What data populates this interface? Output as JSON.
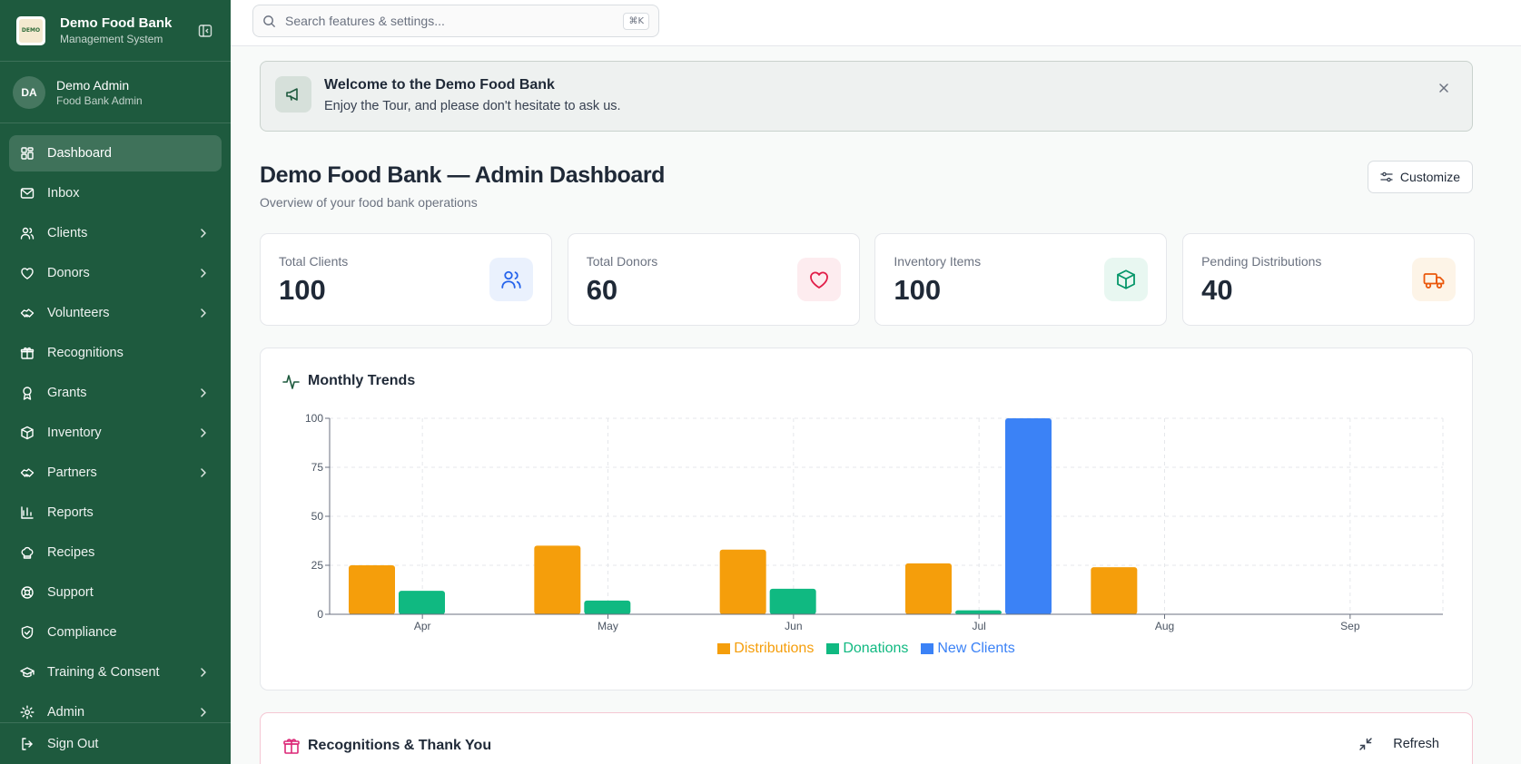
{
  "sidebar": {
    "brand": {
      "name": "Demo Food Bank",
      "subtitle": "Management System",
      "logo_text": "DEMO"
    },
    "user": {
      "initials": "DA",
      "name": "Demo Admin",
      "role": "Food Bank Admin"
    },
    "items": [
      {
        "label": "Dashboard",
        "icon": "dashboard-icon",
        "active": true,
        "has_children": false
      },
      {
        "label": "Inbox",
        "icon": "mail-icon",
        "has_children": false
      },
      {
        "label": "Clients",
        "icon": "users-icon",
        "has_children": true
      },
      {
        "label": "Donors",
        "icon": "heart-icon",
        "has_children": true
      },
      {
        "label": "Volunteers",
        "icon": "handshake-icon",
        "has_children": true
      },
      {
        "label": "Recognitions",
        "icon": "gift-icon",
        "has_children": false
      },
      {
        "label": "Grants",
        "icon": "award-icon",
        "has_children": true
      },
      {
        "label": "Inventory",
        "icon": "box-icon",
        "has_children": true
      },
      {
        "label": "Partners",
        "icon": "handshake-icon",
        "has_children": true
      },
      {
        "label": "Reports",
        "icon": "bar-chart-icon",
        "has_children": false
      },
      {
        "label": "Recipes",
        "icon": "chef-hat-icon",
        "has_children": false
      },
      {
        "label": "Support",
        "icon": "lifebuoy-icon",
        "has_children": false
      },
      {
        "label": "Compliance",
        "icon": "shield-icon",
        "has_children": false
      },
      {
        "label": "Training & Consent",
        "icon": "graduation-cap-icon",
        "has_children": true
      },
      {
        "label": "Admin",
        "icon": "gear-icon",
        "has_children": true
      }
    ],
    "sign_out": "Sign Out"
  },
  "search": {
    "placeholder": "Search features & settings...",
    "shortcut": "⌘K"
  },
  "banner": {
    "title": "Welcome to the Demo Food Bank",
    "text": "Enjoy the Tour, and please don't hesitate to ask us."
  },
  "page": {
    "title": "Demo Food Bank — Admin Dashboard",
    "subtitle": "Overview of your food bank operations",
    "customize_label": "Customize"
  },
  "stats": [
    {
      "label": "Total Clients",
      "value": "100",
      "icon": "users-icon",
      "color": "#2563eb",
      "bg": "#eaf1fd"
    },
    {
      "label": "Total Donors",
      "value": "60",
      "icon": "heart-icon",
      "color": "#e11d48",
      "bg": "#fdecef"
    },
    {
      "label": "Inventory Items",
      "value": "100",
      "icon": "package-icon",
      "color": "#059669",
      "bg": "#e8f7f1"
    },
    {
      "label": "Pending Distributions",
      "value": "40",
      "icon": "truck-icon",
      "color": "#ea580c",
      "bg": "#fdf4e7"
    }
  ],
  "trends": {
    "title": "Monthly Trends"
  },
  "chart_data": {
    "type": "bar",
    "title": "Monthly Trends",
    "categories": [
      "Apr",
      "May",
      "Jun",
      "Jul",
      "Aug",
      "Sep"
    ],
    "series": [
      {
        "name": "Distributions",
        "color": "#f59e0b",
        "values": [
          25,
          35,
          33,
          26,
          24,
          0
        ]
      },
      {
        "name": "Donations",
        "color": "#10b981",
        "values": [
          12,
          7,
          13,
          2,
          0,
          0
        ]
      },
      {
        "name": "New Clients",
        "color": "#3b82f6",
        "values": [
          0,
          0,
          0,
          100,
          0,
          0
        ]
      }
    ],
    "yticks": [
      0,
      25,
      50,
      75,
      100
    ],
    "ylim": [
      0,
      100
    ],
    "grid": true,
    "legend": "bottom"
  },
  "recognitions": {
    "title": "Recognitions & Thank You",
    "refresh_label": "Refresh"
  }
}
